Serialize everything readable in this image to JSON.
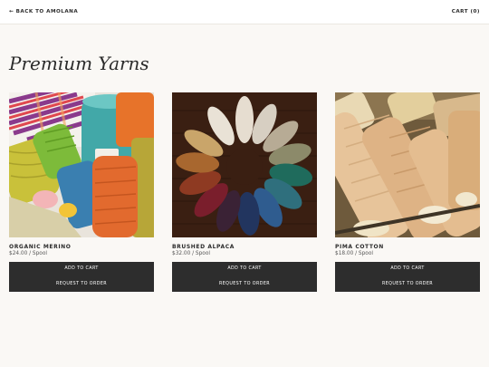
{
  "header": {
    "back_label": "← BACK TO AMOLANA",
    "cart_label": "CART (0)"
  },
  "page": {
    "title": "Premium Yarns"
  },
  "products": [
    {
      "name": "ORGANIC MERINO",
      "price": "$24.00 / Spool",
      "add_label": "ADD TO CART",
      "request_label": "REQUEST TO ORDER"
    },
    {
      "name": "BRUSHED ALPACA",
      "price": "$32.00 / Spool",
      "add_label": "ADD TO CART",
      "request_label": "REQUEST TO ORDER"
    },
    {
      "name": "PIMA COTTON",
      "price": "$18.00 / Spool",
      "add_label": "ADD TO CART",
      "request_label": "REQUEST TO ORDER"
    }
  ],
  "colors": {
    "background": "#faf8f5",
    "button": "#2d2d2d",
    "text": "#2b2b2b"
  }
}
